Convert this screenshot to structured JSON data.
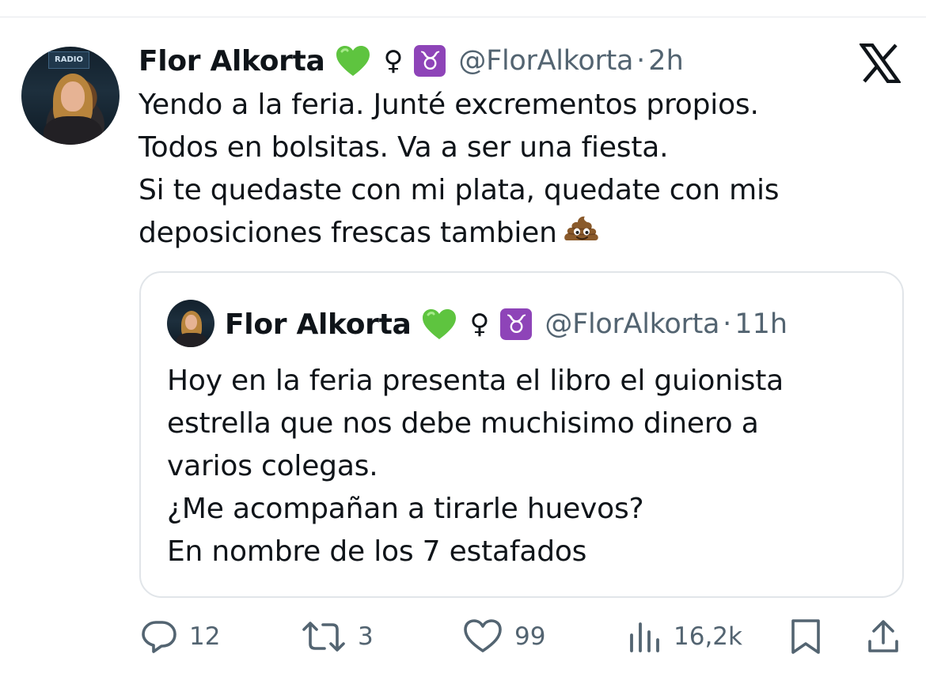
{
  "tweet": {
    "author_name": "Flor Alkorta",
    "badges": [
      "green-heart-emoji",
      "female-sign-emoji",
      "taurus-emoji"
    ],
    "female_sign": "♀",
    "taurus_sign": "♉",
    "handle": "@FlorAlkorta",
    "separator": "·",
    "time": "2h",
    "avatar_sign_text": "RADIO",
    "text_lines": [
      "Yendo a la feria. Junté excrementos propios.",
      "Todos en bolsitas. Va a ser una fiesta.",
      "Si te quedaste con mi plata, quedate con mis",
      "deposiciones frescas tambien"
    ],
    "trailing_emoji": "pile-of-poo-emoji"
  },
  "quoted_tweet": {
    "author_name": "Flor Alkorta",
    "female_sign": "♀",
    "taurus_sign": "♉",
    "handle": "@FlorAlkorta",
    "separator": "·",
    "time": "11h",
    "text_lines": [
      "Hoy en la feria presenta el libro el guionista",
      "estrella que nos debe muchisimo dinero a",
      "varios colegas.",
      "¿Me acompañan a tirarle huevos?",
      "En nombre de los 7 estafados"
    ]
  },
  "actions": {
    "replies": "12",
    "reposts": "3",
    "likes": "99",
    "views": "16,2k"
  },
  "colors": {
    "text_primary": "#0f1419",
    "text_secondary": "#536471",
    "border": "#e1e5e9",
    "heart_green": "#5ec43f",
    "taurus_purple": "#8e44b8"
  },
  "icons": {
    "platform_logo": "x-logo-icon",
    "reply": "reply-icon",
    "repost": "repost-icon",
    "like": "like-icon",
    "views": "views-icon",
    "bookmark": "bookmark-icon",
    "share": "share-icon"
  }
}
